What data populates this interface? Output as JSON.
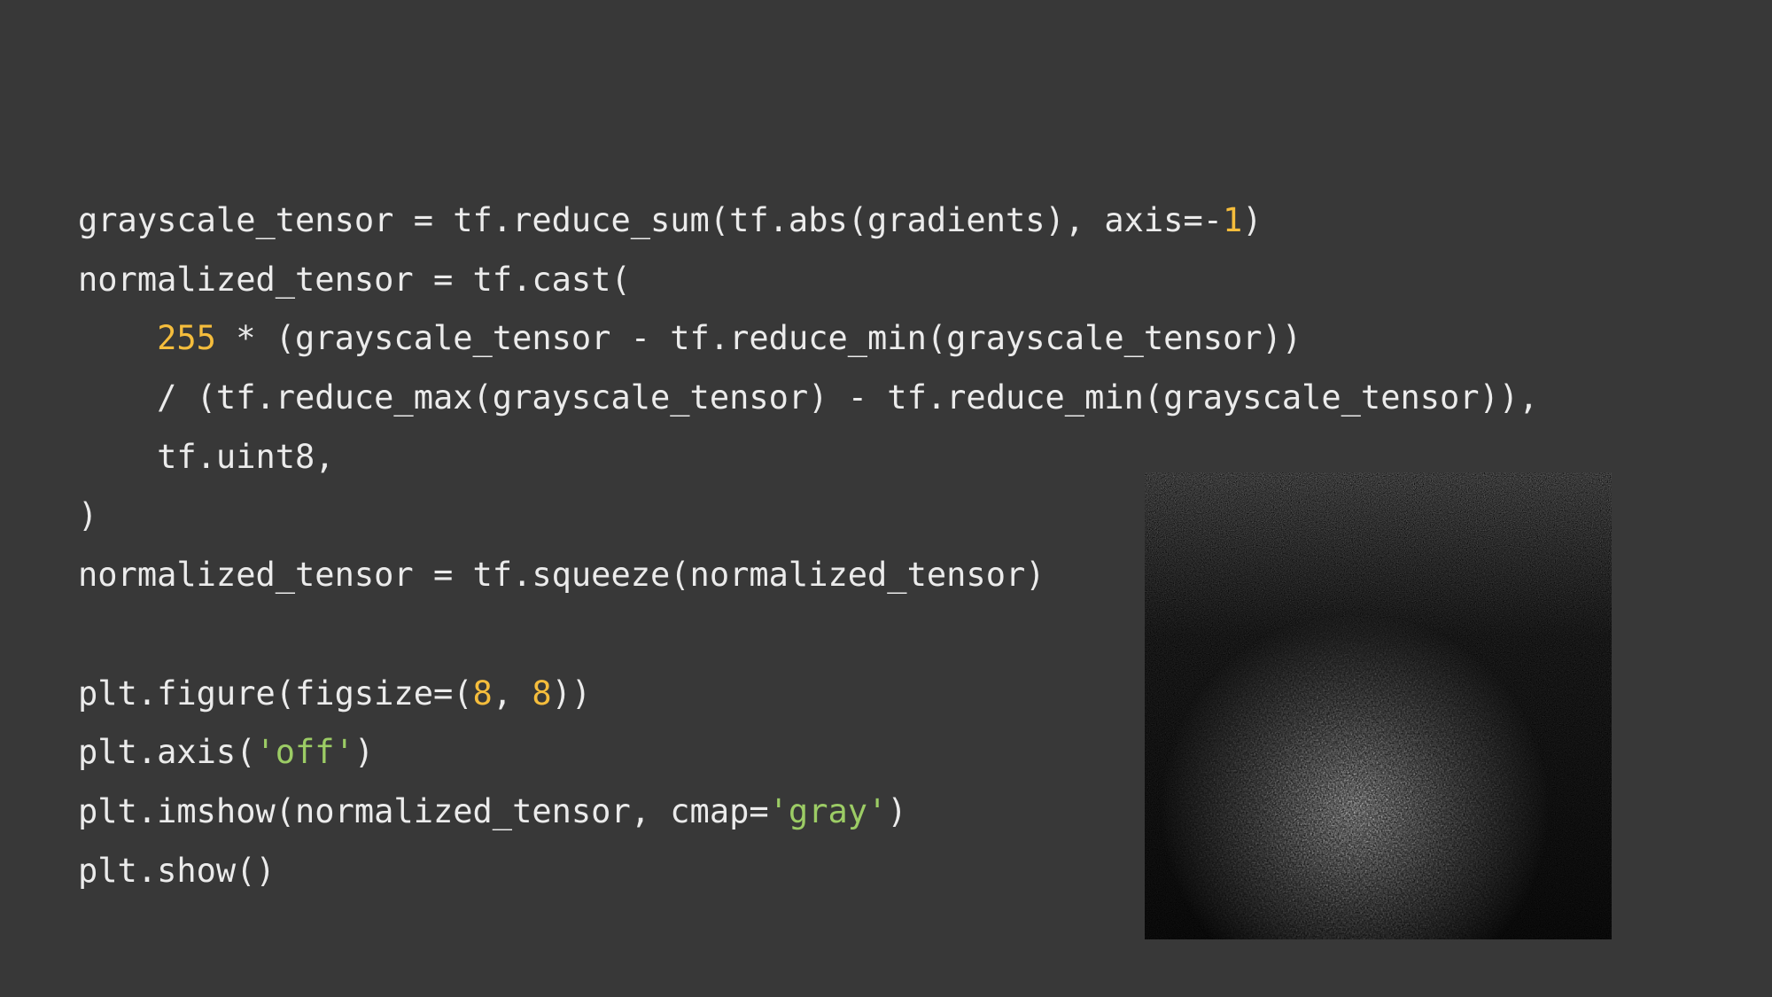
{
  "colors": {
    "background": "#383838",
    "code_text": "#ebebeb",
    "number": "#f5bd3c",
    "string": "#9ccc65",
    "image_bg": "#000000"
  },
  "code": {
    "lines": [
      [
        {
          "t": "grayscale_tensor = tf.reduce_sum(tf.abs(gradients), axis=-"
        },
        {
          "t": "1",
          "c": "num"
        },
        {
          "t": ")"
        }
      ],
      [
        {
          "t": "normalized_tensor = tf.cast("
        }
      ],
      [
        {
          "t": "    "
        },
        {
          "t": "255",
          "c": "num"
        },
        {
          "t": " * (grayscale_tensor - tf.reduce_min(grayscale_tensor))"
        }
      ],
      [
        {
          "t": "    / (tf.reduce_max(grayscale_tensor) - tf.reduce_min(grayscale_tensor)),"
        }
      ],
      [
        {
          "t": "    tf.uint8,"
        }
      ],
      [
        {
          "t": ")"
        }
      ],
      [
        {
          "t": "normalized_tensor = tf.squeeze(normalized_tensor)"
        }
      ],
      [],
      [
        {
          "t": "plt.figure(figsize=("
        },
        {
          "t": "8",
          "c": "num"
        },
        {
          "t": ", "
        },
        {
          "t": "8",
          "c": "num"
        },
        {
          "t": "))"
        }
      ],
      [
        {
          "t": "plt.axis("
        },
        {
          "t": "'off'",
          "c": "str"
        },
        {
          "t": ")"
        }
      ],
      [
        {
          "t": "plt.imshow(normalized_tensor, cmap="
        },
        {
          "t": "'gray'",
          "c": "str"
        },
        {
          "t": ")"
        }
      ],
      [
        {
          "t": "plt.show()"
        }
      ]
    ]
  },
  "output_image": {
    "kind": "grayscale saliency map (noise, brighter region lower-center)"
  }
}
